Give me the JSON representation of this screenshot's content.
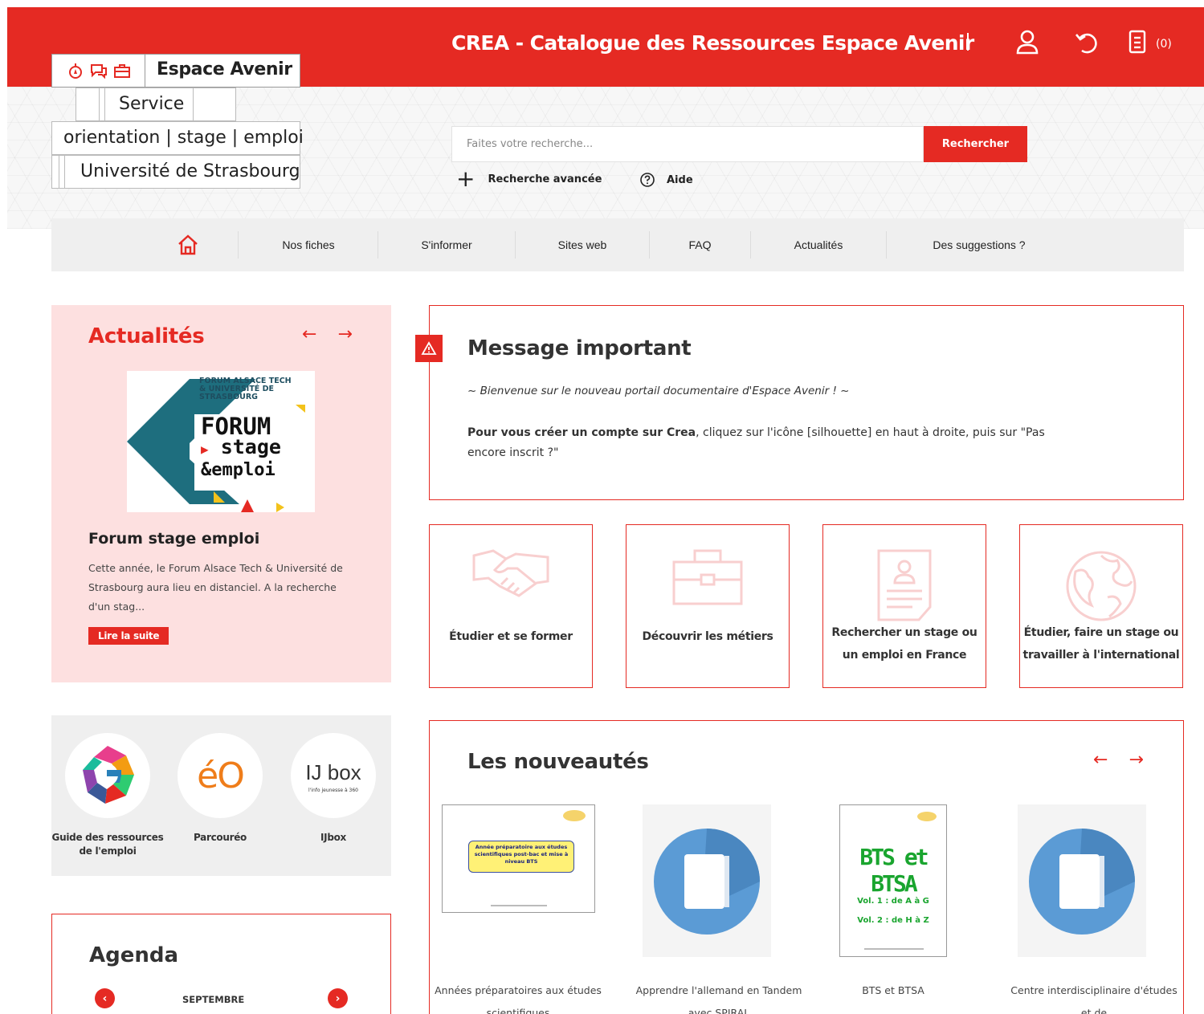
{
  "header": {
    "site_title": "CREA - Catalogue des Ressources Espace Avenir",
    "basket_count": "(0)",
    "icons": [
      "user-icon",
      "history-icon",
      "basket-icon"
    ]
  },
  "logo": {
    "name": "Espace Avenir",
    "service": "Service",
    "tagline": "orientation | stage | emploi",
    "university": "Université de Strasbourg"
  },
  "search": {
    "placeholder": "Faites votre recherche...",
    "button": "Rechercher",
    "advanced": "Recherche avancée",
    "help": "Aide"
  },
  "nav": {
    "items": [
      "Nos fiches",
      "S'informer",
      "Sites web",
      "FAQ",
      "Actualités",
      "Des suggestions ?"
    ]
  },
  "actualites": {
    "title": "Actualités",
    "image_text": {
      "line1": "FORUM ALSACE TECH",
      "line2": "& UNIVERSITÉ DE STRASBOURG",
      "line3": "FORUM",
      "line4": "stage",
      "line5": "&emploi"
    },
    "news_title": "Forum stage emploi",
    "news_text": "Cette année, le Forum Alsace Tech & Université de Strasbourg aura lieu en distanciel. A la recherche d'un stag...",
    "read_more": "Lire la suite"
  },
  "message": {
    "title": "Message important",
    "welcome": "~ Bienvenue sur le nouveau portail documentaire d'Espace Avenir ! ~",
    "body_bold": "Pour vous créer un compte sur Crea",
    "body_rest": ", cliquez sur l'icône [silhouette] en haut à droite, puis sur \"Pas encore inscrit ?\""
  },
  "tiles": [
    {
      "label": "Étudier et se former",
      "icon": "handshake-icon"
    },
    {
      "label": "Découvrir les métiers",
      "icon": "briefcase-icon"
    },
    {
      "label": "Rechercher un stage ou un emploi en France",
      "icon": "cv-document-icon"
    },
    {
      "label": "Étudier, faire un stage ou travailler à l'international",
      "icon": "globe-icon"
    }
  ],
  "partners": [
    {
      "label": "Guide des ressources de l'emploi",
      "logo_text": "G"
    },
    {
      "label": "Parcouréo",
      "logo_text": "éO"
    },
    {
      "label": "IJbox",
      "logo_text": "IJ box",
      "logo_sub": "l'info jeunesse à 360"
    }
  ],
  "agenda": {
    "title": "Agenda",
    "month": "SEPTEMBRE"
  },
  "nouveautes": {
    "title": "Les nouveautés",
    "books": [
      {
        "caption": "Années préparatoires aux études scientifiques",
        "cover": "doc",
        "cover_text": "Année préparatoire aux études scientifiques post-bac et mise à niveau BTS"
      },
      {
        "caption": "Apprendre l'allemand en Tandem avec SPIRAL",
        "cover": "generic"
      },
      {
        "caption": "BTS et BTSA",
        "cover": "bts",
        "cover_title": "BTS et BTSA",
        "cover_vol1": "Vol. 1 : de A à G",
        "cover_vol2": "Vol. 2 : de H à Z"
      },
      {
        "caption": "Centre interdisciplinaire d'études et de",
        "cover": "generic"
      }
    ]
  },
  "colors": {
    "brand_red": "#e52a23",
    "pink_panel": "#fde0e0",
    "nav_grey": "#efefef"
  }
}
